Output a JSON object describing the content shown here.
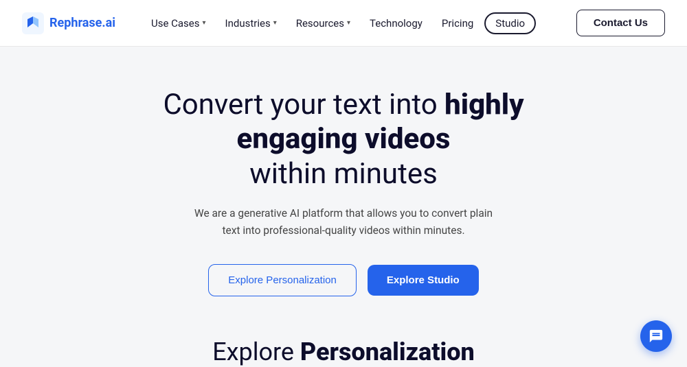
{
  "logo": {
    "text": "Rephrase.ai"
  },
  "nav": {
    "use_cases": "Use Cases",
    "industries": "Industries",
    "resources": "Resources",
    "technology": "Technology",
    "pricing": "Pricing",
    "studio": "Studio",
    "contact": "Contact Us"
  },
  "hero": {
    "title_normal": "Convert your text into",
    "title_bold": "highly engaging videos",
    "title_end": "within minutes",
    "subtitle": "We are a generative AI platform that allows you to convert plain text into professional-quality videos within minutes.",
    "btn_explore_personalization": "Explore Personalization",
    "btn_explore_studio": "Explore Studio"
  },
  "section": {
    "title_normal": "Explore",
    "title_bold": "Personalization"
  }
}
